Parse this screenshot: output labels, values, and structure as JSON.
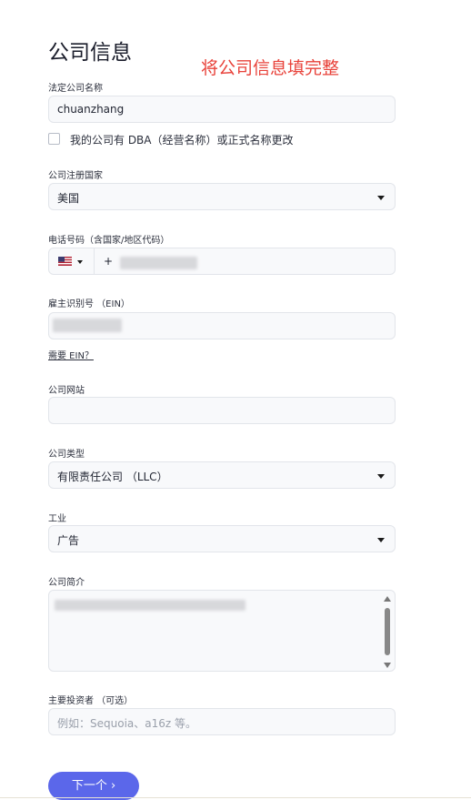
{
  "header": {
    "title": "公司信息",
    "annotation": "将公司信息填完整"
  },
  "fields": {
    "legal_name": {
      "label": "法定公司名称",
      "value": "chuanzhang"
    },
    "dba": {
      "label": "我的公司有 DBA（经营名称）或正式名称更改",
      "checked": false
    },
    "country": {
      "label": "公司注册国家",
      "value": "美国"
    },
    "phone": {
      "label": "电话号码（含国家/地区代码）",
      "flag_icon": "us-flag-icon",
      "prefix": "+"
    },
    "ein": {
      "label": "雇主识别号 （EIN）",
      "help_link": "需要 EIN？"
    },
    "website": {
      "label": "公司网站",
      "value": ""
    },
    "company_type": {
      "label": "公司类型",
      "value": "有限责任公司 （LLC）"
    },
    "industry": {
      "label": "工业",
      "value": "广告"
    },
    "description": {
      "label": "公司简介"
    },
    "investors": {
      "label": "主要投资者 （可选）",
      "placeholder": "例如：Sequoia、a16z 等。"
    }
  },
  "actions": {
    "next_label": "下一个 ›"
  },
  "colors": {
    "primary": "#5b67ea",
    "annotation": "#e8423a",
    "field_bg": "#f8f9fb"
  }
}
